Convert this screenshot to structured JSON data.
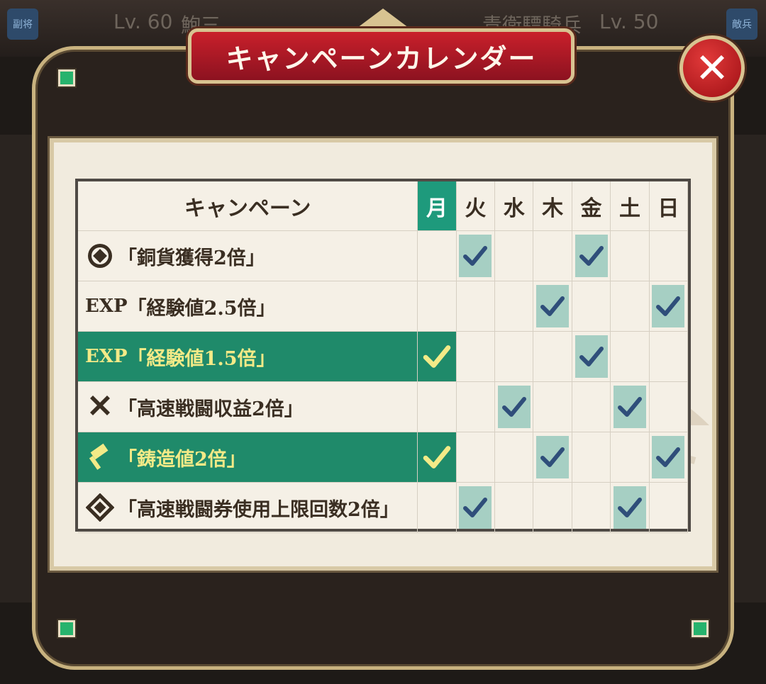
{
  "background": {
    "left_level": "Lv. 60",
    "left_name": "鮑三",
    "right_name": "青衛驃騎兵",
    "right_level": "Lv. 50",
    "left_badge": "副将",
    "right_badge": "敵兵"
  },
  "dialog": {
    "title": "キャンペーンカレンダー",
    "close_label": "✕"
  },
  "table": {
    "header_campaign": "キャンペーン",
    "days": [
      "月",
      "火",
      "水",
      "木",
      "金",
      "土",
      "日"
    ],
    "today_index": 0,
    "rows": [
      {
        "icon": "copper-coin-icon",
        "prefix": "",
        "label": "「銅貨獲得2倍」",
        "active": false,
        "days": [
          false,
          true,
          false,
          false,
          true,
          false,
          false
        ]
      },
      {
        "icon": "exp-icon",
        "prefix": "EXP",
        "label": "「経験値2.5倍」",
        "active": false,
        "days": [
          false,
          false,
          false,
          true,
          false,
          false,
          true
        ]
      },
      {
        "icon": "exp-icon",
        "prefix": "EXP",
        "label": "「経験値1.5倍」",
        "active": true,
        "days": [
          true,
          false,
          false,
          false,
          true,
          false,
          false
        ]
      },
      {
        "icon": "crossed-swords-icon",
        "prefix": "",
        "label": "「高速戦闘収益2倍」",
        "active": false,
        "days": [
          false,
          false,
          true,
          false,
          false,
          true,
          false
        ]
      },
      {
        "icon": "hammer-icon",
        "prefix": "",
        "label": "「鋳造値2倍」",
        "active": true,
        "days": [
          true,
          false,
          false,
          true,
          false,
          false,
          true
        ]
      },
      {
        "icon": "ticket-diamond-icon",
        "prefix": "",
        "label": "「高速戦闘券使用上限回数2倍」",
        "active": false,
        "days": [
          false,
          true,
          false,
          false,
          false,
          true,
          false
        ]
      }
    ]
  },
  "colors": {
    "today": "#1e9a7c",
    "active_row": "#1f8a6a",
    "active_text": "#f3ea87",
    "check_bg": "#a6cfc3",
    "check_color": "#2f4e7a",
    "today_check_color": "#f3ea87"
  }
}
